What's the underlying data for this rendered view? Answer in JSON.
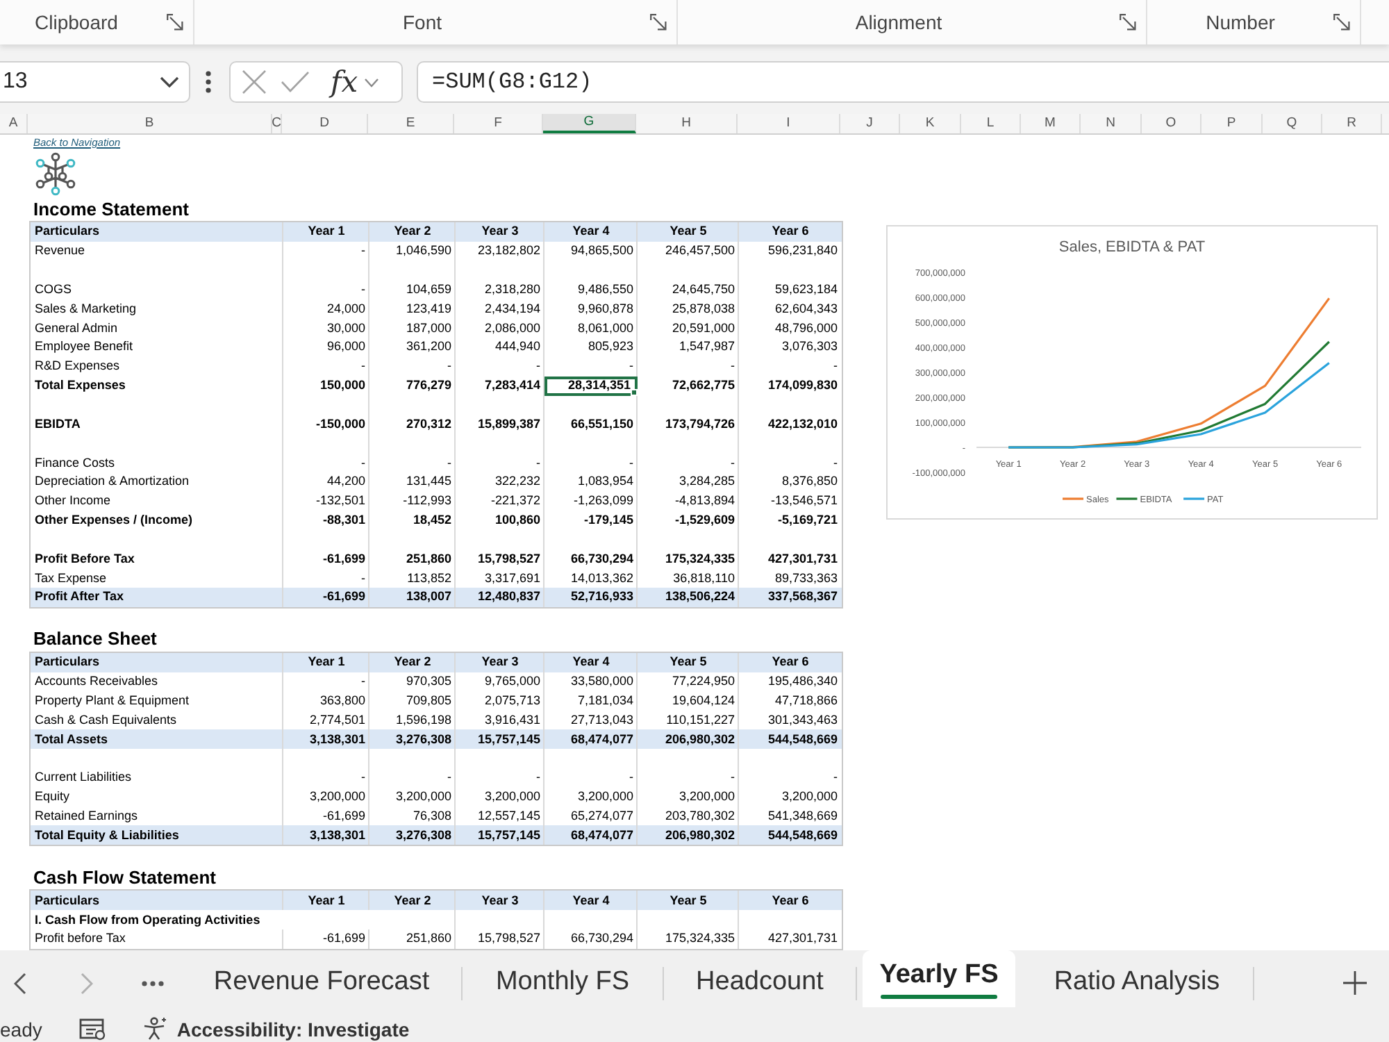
{
  "ribbon": {
    "groups": [
      {
        "label": "Clipboard"
      },
      {
        "label": "Font"
      },
      {
        "label": "Alignment"
      },
      {
        "label": "Number"
      }
    ]
  },
  "formula_bar": {
    "name_box": "13",
    "function_button": "fx",
    "formula": "=SUM(G8:G12)"
  },
  "column_headers": [
    {
      "label": "A",
      "selected": false
    },
    {
      "label": "B",
      "selected": false
    },
    {
      "label": "C",
      "selected": false
    },
    {
      "label": "D",
      "selected": false
    },
    {
      "label": "E",
      "selected": false
    },
    {
      "label": "F",
      "selected": false
    },
    {
      "label": "G",
      "selected": true
    },
    {
      "label": "H",
      "selected": false
    },
    {
      "label": "I",
      "selected": false
    },
    {
      "label": "J",
      "selected": false
    },
    {
      "label": "K",
      "selected": false
    },
    {
      "label": "L",
      "selected": false
    },
    {
      "label": "M",
      "selected": false
    },
    {
      "label": "N",
      "selected": false
    },
    {
      "label": "O",
      "selected": false
    },
    {
      "label": "P",
      "selected": false
    },
    {
      "label": "Q",
      "selected": false
    },
    {
      "label": "R",
      "selected": false
    }
  ],
  "sheet": {
    "back_link": "Back to Navigation",
    "sections": [
      {
        "title": "Income Statement",
        "columns": [
          "Particulars",
          "Year 1",
          "Year 2",
          "Year 3",
          "Year 4",
          "Year 5",
          "Year 6"
        ],
        "rows": [
          {
            "kind": "item",
            "label": "Revenue",
            "values": [
              "-",
              "1,046,590",
              "23,182,802",
              "94,865,500",
              "246,457,500",
              "596,231,840"
            ]
          },
          {
            "kind": "blank"
          },
          {
            "kind": "item",
            "label": "COGS",
            "values": [
              "-",
              "104,659",
              "2,318,280",
              "9,486,550",
              "24,645,750",
              "59,623,184"
            ]
          },
          {
            "kind": "item",
            "label": "Sales & Marketing",
            "values": [
              "24,000",
              "123,419",
              "2,434,194",
              "9,960,878",
              "25,878,038",
              "62,604,343"
            ]
          },
          {
            "kind": "item",
            "label": "General Admin",
            "values": [
              "30,000",
              "187,000",
              "2,086,000",
              "8,061,000",
              "20,591,000",
              "48,796,000"
            ]
          },
          {
            "kind": "item",
            "label": "Employee Benefit",
            "values": [
              "96,000",
              "361,200",
              "444,940",
              "805,923",
              "1,547,987",
              "3,076,303"
            ]
          },
          {
            "kind": "item",
            "label": "R&D Expenses",
            "values": [
              "-",
              "-",
              "-",
              "-",
              "-",
              "-"
            ]
          },
          {
            "kind": "total",
            "label": "Total Expenses",
            "values": [
              {
                "text": "150,000",
                "selected": false
              },
              {
                "text": "776,279",
                "selected": false
              },
              {
                "text": "7,283,414",
                "selected": false
              },
              {
                "text": "28,314,351",
                "selected": true
              },
              {
                "text": "72,662,775",
                "selected": false
              },
              {
                "text": "174,099,830",
                "selected": false
              }
            ]
          },
          {
            "kind": "blank"
          },
          {
            "kind": "total",
            "label": "EBIDTA",
            "values": [
              "-150,000",
              "270,312",
              "15,899,387",
              "66,551,150",
              "173,794,726",
              "422,132,010"
            ]
          },
          {
            "kind": "blank"
          },
          {
            "kind": "item",
            "label": "Finance Costs",
            "values": [
              "-",
              "-",
              "-",
              "-",
              "-",
              "-"
            ]
          },
          {
            "kind": "item",
            "label": "Depreciation & Amortization",
            "values": [
              "44,200",
              "131,445",
              "322,232",
              "1,083,954",
              "3,284,285",
              "8,376,850"
            ]
          },
          {
            "kind": "item",
            "label": "Other Income",
            "values": [
              "-132,501",
              "-112,993",
              "-221,372",
              "-1,263,099",
              "-4,813,894",
              "-13,546,571"
            ]
          },
          {
            "kind": "total",
            "label": "Other Expenses / (Income)",
            "values": [
              "-88,301",
              "18,452",
              "100,860",
              "-179,145",
              "-1,529,609",
              "-5,169,721"
            ]
          },
          {
            "kind": "blank"
          },
          {
            "kind": "total",
            "label": "Profit Before Tax",
            "values": [
              "-61,699",
              "251,860",
              "15,798,527",
              "66,730,294",
              "175,324,335",
              "427,301,731"
            ]
          },
          {
            "kind": "item",
            "label": "Tax Expense",
            "values": [
              "-",
              "113,852",
              "3,317,691",
              "14,013,362",
              "36,818,110",
              "89,733,363"
            ]
          },
          {
            "kind": "shaded_total",
            "label": "Profit After Tax",
            "values": [
              "-61,699",
              "138,007",
              "12,480,837",
              "52,716,933",
              "138,506,224",
              "337,568,367"
            ]
          }
        ]
      },
      {
        "title": "Balance Sheet",
        "columns": [
          "Particulars",
          "Year 1",
          "Year 2",
          "Year 3",
          "Year 4",
          "Year 5",
          "Year 6"
        ],
        "rows": [
          {
            "kind": "item",
            "label": "Accounts Receivables",
            "values": [
              "-",
              "970,305",
              "9,765,000",
              "33,580,000",
              "77,224,950",
              "195,486,340"
            ]
          },
          {
            "kind": "item",
            "label": "Property Plant & Equipment",
            "values": [
              "363,800",
              "709,805",
              "2,075,713",
              "7,181,034",
              "19,604,124",
              "47,718,866"
            ]
          },
          {
            "kind": "item",
            "label": "Cash & Cash Equivalents",
            "values": [
              "2,774,501",
              "1,596,198",
              "3,916,431",
              "27,713,043",
              "110,151,227",
              "301,343,463"
            ]
          },
          {
            "kind": "shaded_total",
            "label": "Total Assets",
            "values": [
              "3,138,301",
              "3,276,308",
              "15,757,145",
              "68,474,077",
              "206,980,302",
              "544,548,669"
            ]
          },
          {
            "kind": "blank"
          },
          {
            "kind": "item",
            "label": "Current Liabilities",
            "values": [
              "-",
              "-",
              "-",
              "-",
              "-",
              "-"
            ]
          },
          {
            "kind": "item",
            "label": "Equity",
            "values": [
              "3,200,000",
              "3,200,000",
              "3,200,000",
              "3,200,000",
              "3,200,000",
              "3,200,000"
            ]
          },
          {
            "kind": "item",
            "label": "Retained Earnings",
            "values": [
              "-61,699",
              "76,308",
              "12,557,145",
              "65,274,077",
              "203,780,302",
              "541,348,669"
            ]
          },
          {
            "kind": "shaded_total",
            "label": "Total Equity & Liabilities",
            "values": [
              "3,138,301",
              "3,276,308",
              "15,757,145",
              "68,474,077",
              "206,980,302",
              "544,548,669"
            ]
          }
        ]
      },
      {
        "title": "Cash Flow Statement",
        "columns": [
          "Particulars",
          "Year 1",
          "Year 2",
          "Year 3",
          "Year 4",
          "Year 5",
          "Year 6"
        ],
        "rows": [
          {
            "kind": "section",
            "label": "I. Cash Flow from Operating Activities"
          },
          {
            "kind": "item",
            "label": "Profit before Tax",
            "values": [
              "-61,699",
              "251,860",
              "15,798,527",
              "66,730,294",
              "175,324,335",
              "427,301,731"
            ]
          }
        ]
      }
    ]
  },
  "chart": {
    "chart_data": {
      "type": "line",
      "title": "Sales, EBIDTA & PAT",
      "categories": [
        "Year 1",
        "Year 2",
        "Year 3",
        "Year 4",
        "Year 5",
        "Year 6"
      ],
      "series": [
        {
          "name": "Sales",
          "color": "#ed7d31",
          "values": [
            0,
            1000000,
            23000000,
            95000000,
            246000000,
            596000000
          ]
        },
        {
          "name": "EBIDTA",
          "color": "#217a33",
          "values": [
            0,
            0,
            16000000,
            67000000,
            174000000,
            422000000
          ]
        },
        {
          "name": "PAT",
          "color": "#2aa3dc",
          "values": [
            0,
            0,
            12000000,
            53000000,
            139000000,
            338000000
          ]
        }
      ],
      "ylim": [
        -100000000,
        700000000
      ],
      "yticks": [
        {
          "value": 700000000,
          "label": "700,000,000"
        },
        {
          "value": 600000000,
          "label": "600,000,000"
        },
        {
          "value": 500000000,
          "label": "500,000,000"
        },
        {
          "value": 400000000,
          "label": "400,000,000"
        },
        {
          "value": 300000000,
          "label": "300,000,000"
        },
        {
          "value": 200000000,
          "label": "200,000,000"
        },
        {
          "value": 100000000,
          "label": "100,000,000"
        },
        {
          "value": 0,
          "label": "-"
        },
        {
          "value": -100000000,
          "label": "-100,000,000"
        }
      ],
      "legend": "bottom"
    }
  },
  "sheet_tabs": {
    "nav_buttons": [
      {
        "kind": "previous",
        "disabled": false
      },
      {
        "kind": "next",
        "disabled": true
      },
      {
        "kind": "more",
        "disabled": false
      }
    ],
    "tabs": [
      {
        "label": "Revenue Forecast",
        "selected": false
      },
      {
        "label": "Monthly FS",
        "selected": false
      },
      {
        "label": "Headcount",
        "selected": false
      },
      {
        "label": "Yearly FS",
        "selected": true
      },
      {
        "label": "Ratio Analysis",
        "selected": false
      }
    ]
  },
  "status_bar": {
    "mode": "eady",
    "accessibility": "Accessibility: Investigate"
  }
}
